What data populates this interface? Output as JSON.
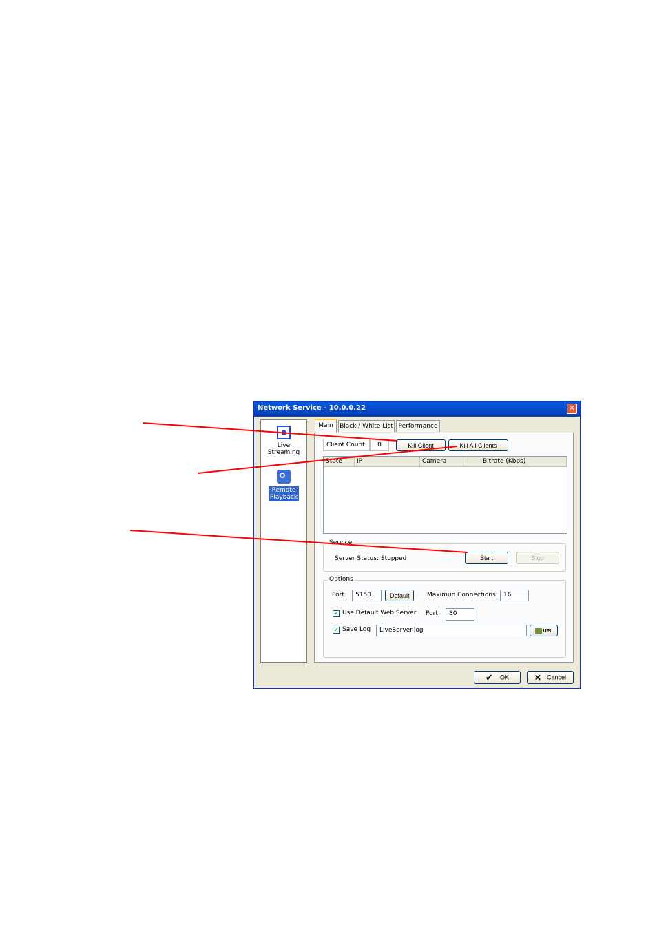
{
  "window": {
    "title": "Network Service - 10.0.0.22",
    "close_glyph": "✕"
  },
  "sidebar": {
    "items": [
      {
        "label_line1": "Live",
        "label_line2": "Streaming",
        "icon": "live-streaming-icon"
      },
      {
        "label_line1": "Remote",
        "label_line2": "Playback",
        "icon": "remote-playback-icon",
        "selected": true
      }
    ]
  },
  "tabs": [
    {
      "label": "Main",
      "active": true
    },
    {
      "label": "Black / White List"
    },
    {
      "label": "Performance"
    }
  ],
  "clients": {
    "count_label": "Client Count",
    "count_value": "0",
    "kill_client_label": "Kill Client",
    "kill_all_label": "Kill All Clients",
    "columns": [
      "State",
      "IP",
      "Camera",
      "Bitrate (Kbps)"
    ],
    "rows": []
  },
  "service": {
    "legend": "Service",
    "status_text": "Server Status: Stopped",
    "start_label": "Start",
    "stop_label": "Stop"
  },
  "options": {
    "legend": "Options",
    "port_label": "Port",
    "port_value": "5150",
    "default_label": "Default",
    "max_conn_label": "Maximun Connections:",
    "max_conn_value": "16",
    "use_web_server_label": "Use Default Web Server",
    "use_web_server_checked": true,
    "web_port_label": "Port",
    "web_port_value": "80",
    "save_log_label": "Save Log",
    "save_log_checked": true,
    "log_file_value": "LiveServer.log",
    "browse_label": "UPL"
  },
  "footer": {
    "ok_label": "OK",
    "cancel_label": "Cancel"
  },
  "colors": {
    "annotation": "#ff0000",
    "title_bar": "#0548c8",
    "selection": "#3165c5"
  }
}
